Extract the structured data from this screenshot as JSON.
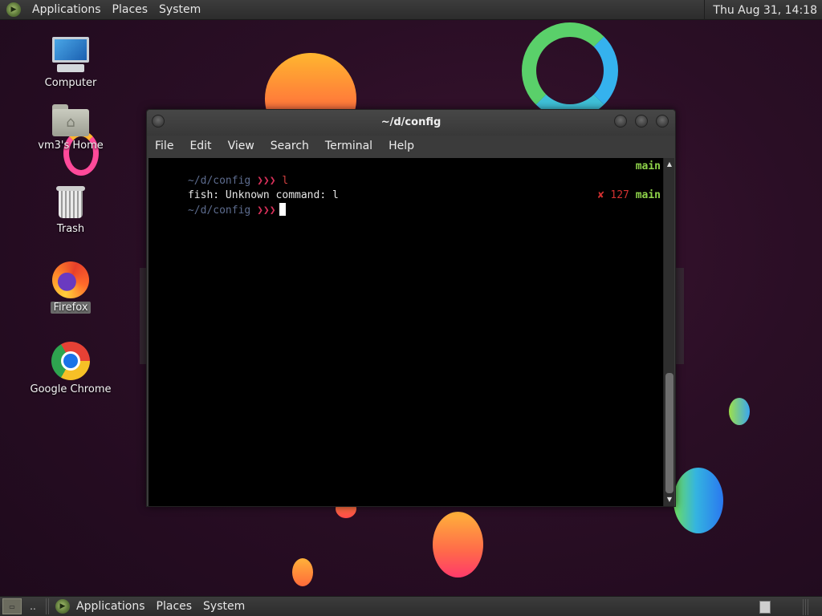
{
  "top_panel": {
    "menu": [
      "Applications",
      "Places",
      "System"
    ],
    "clock": "Thu Aug 31, 14:18"
  },
  "bottom_panel": {
    "files_label": "▭",
    "dots_label": "..",
    "menu": [
      "Applications",
      "Places",
      "System"
    ]
  },
  "desktop_icons": [
    {
      "label": "Computer",
      "icon": "computer-icon"
    },
    {
      "label": "vm3's Home",
      "icon": "home-folder-icon"
    },
    {
      "label": "Trash",
      "icon": "trash-icon"
    },
    {
      "label": "Firefox",
      "icon": "firefox-icon"
    },
    {
      "label": "Google Chrome",
      "icon": "chrome-icon"
    }
  ],
  "terminal": {
    "title": "~/d/config",
    "menu": [
      "File",
      "Edit",
      "View",
      "Search",
      "Terminal",
      "Help"
    ],
    "lines": [
      {
        "path": "~/d/config",
        "prompt": "❯❯❯",
        "cmd": "l",
        "right_branch": "main"
      },
      {
        "output": "fish: Unknown command: l"
      },
      {
        "path": "~/d/config",
        "prompt": "❯❯❯",
        "right_status": "✘ 127",
        "right_branch": "main"
      }
    ]
  },
  "colors": {
    "prompt_path": "#5d6c8e",
    "branch": "#8fd44a",
    "error": "#d23030"
  }
}
